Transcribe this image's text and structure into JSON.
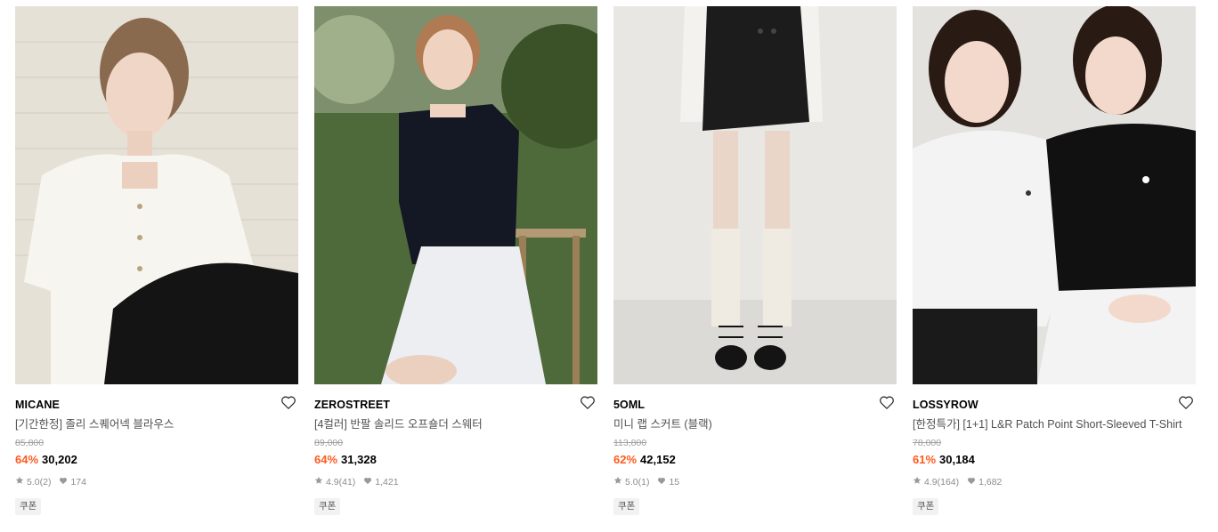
{
  "colors": {
    "discount": "#ff5a1f",
    "muted": "#8c8c8c",
    "badge_bg": "#f2f2f2"
  },
  "icons": {
    "wish": "heart-outline-icon",
    "rating": "star-icon",
    "likes": "heart-filled-icon"
  },
  "products": [
    {
      "brand": "MICANE",
      "name": "[기간한정] 졸리 스퀘어넥 블라우스",
      "original_price": "85,800",
      "discount": "64%",
      "price": "30,202",
      "rating": "5.0",
      "reviews": "(2)",
      "likes": "174",
      "badge": "쿠폰"
    },
    {
      "brand": "ZEROSTREET",
      "name": "[4컬러] 반팔 솔리드 오프숄더 스웨터",
      "original_price": "89,000",
      "discount": "64%",
      "price": "31,328",
      "rating": "4.9",
      "reviews": "(41)",
      "likes": "1,421",
      "badge": "쿠폰"
    },
    {
      "brand": "5OML",
      "name": "미니 랩 스커트 (블랙)",
      "original_price": "113,800",
      "discount": "62%",
      "price": "42,152",
      "rating": "5.0",
      "reviews": "(1)",
      "likes": "15",
      "badge": "쿠폰"
    },
    {
      "brand": "LOSSYROW",
      "name": "[한정특가] [1+1] L&R Patch Point Short-Sleeved T-Shirt",
      "original_price": "78,000",
      "discount": "61%",
      "price": "30,184",
      "rating": "4.9",
      "reviews": "(164)",
      "likes": "1,682",
      "badge": "쿠폰"
    }
  ]
}
